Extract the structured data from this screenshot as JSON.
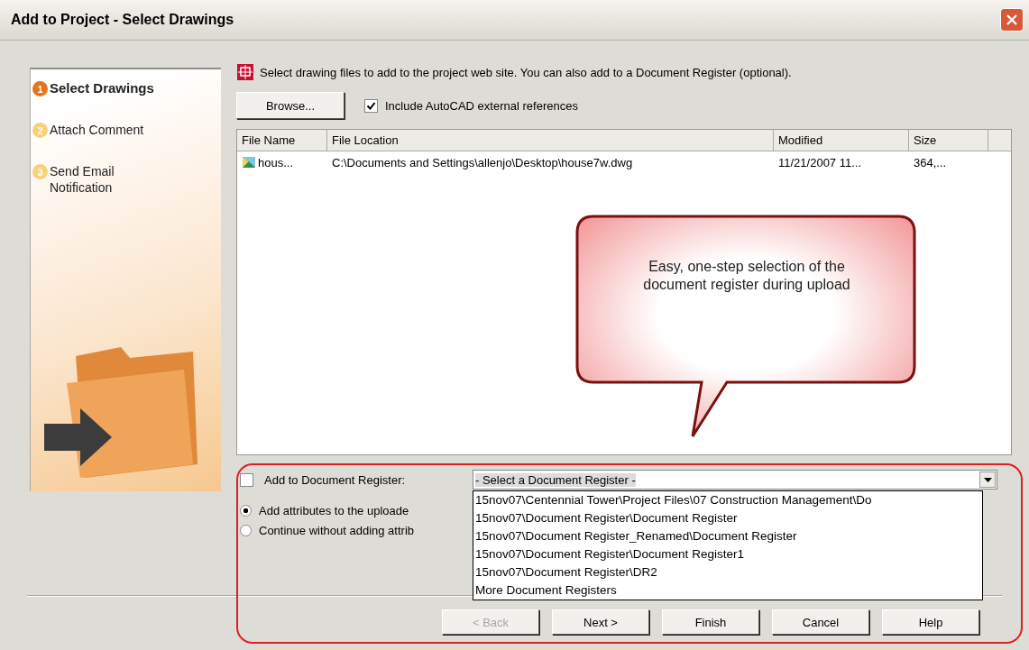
{
  "window": {
    "title": "Add to Project - Select Drawings"
  },
  "steps": [
    {
      "number": "1",
      "label": "Select Drawings",
      "selected": true
    },
    {
      "number": "2",
      "label": "Attach Comment",
      "selected": false
    },
    {
      "number": "3",
      "label": "Send Email Notification",
      "selected": false
    }
  ],
  "intro": "Select drawing files to add to the project web site. You can also add to a Document Register (optional).",
  "browse_button": "Browse...",
  "include_xrefs": {
    "label": "Include AutoCAD external references",
    "checked": true
  },
  "table": {
    "columns": [
      "File Name",
      "File Location",
      "Modified",
      "Size"
    ],
    "rows": [
      {
        "file_name": "hous...",
        "file_location": "C:\\Documents and Settings\\allenjo\\Desktop\\house7w.dwg",
        "modified": "11/21/2007  11...",
        "size": "364,..."
      }
    ]
  },
  "callout": "Easy, one-step selection of the document register during upload",
  "register": {
    "label": "Add to Document Register:",
    "checked": false,
    "value": "- Select a Document Register -",
    "expanded": true,
    "options": [
      "15nov07\\Centennial Tower\\Project Files\\07 Construction Management\\Do",
      "15nov07\\Document Register\\Document Register",
      "15nov07\\Document Register_Renamed\\Document Register",
      "15nov07\\Document Register\\Document Register1",
      "15nov07\\Document Register\\DR2",
      "More Document Registers"
    ]
  },
  "radios": [
    {
      "label": "Add attributes to the uploade",
      "selected": true
    },
    {
      "label": "Continue without adding attrib",
      "selected": false
    }
  ],
  "buttons": [
    {
      "label": "< Back",
      "disabled": true
    },
    {
      "label": "Next >",
      "disabled": false
    },
    {
      "label": "Finish",
      "disabled": false
    },
    {
      "label": "Cancel",
      "disabled": false
    },
    {
      "label": "Help",
      "disabled": false
    }
  ]
}
